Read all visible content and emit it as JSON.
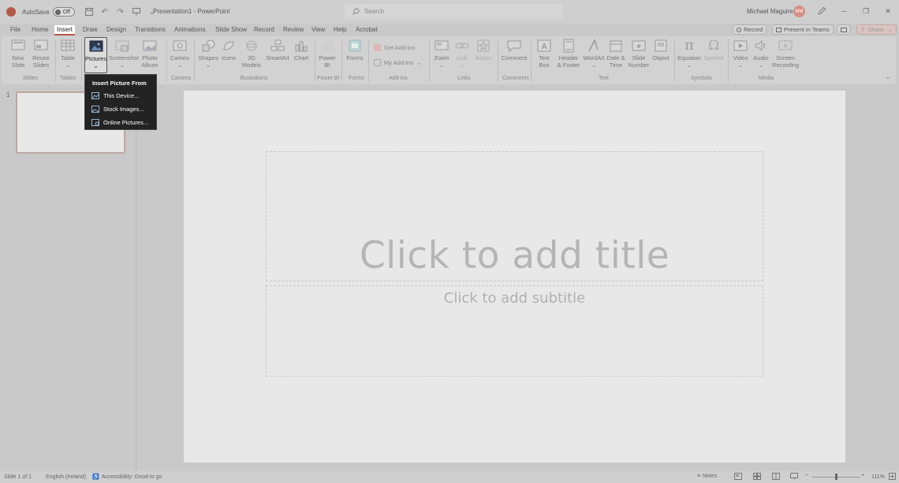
{
  "titlebar": {
    "autosave_label": "AutoSave",
    "autosave_state": "Off",
    "doc_title": "Presentation1  -  PowerPoint",
    "search_placeholder": "Search",
    "user_name": "Michael Maguire",
    "user_initials": "MM"
  },
  "tabs": [
    "File",
    "Home",
    "Insert",
    "Draw",
    "Design",
    "Transitions",
    "Animations",
    "Slide Show",
    "Record",
    "Review",
    "View",
    "Help",
    "Acrobat"
  ],
  "top_right": {
    "record": "Record",
    "present": "Present in Teams",
    "share": "Share"
  },
  "ribbon": {
    "new_slide": [
      "New",
      "Slide"
    ],
    "reuse_slides": [
      "Reuse",
      "Slides"
    ],
    "table": "Table",
    "pictures": "Pictures",
    "screenshot": "Screenshot",
    "photo_album": [
      "Photo",
      "Album"
    ],
    "cameo": "Cameo",
    "shapes": "Shapes",
    "icons": "Icons",
    "models3d": [
      "3D",
      "Models"
    ],
    "smartart": "SmartArt",
    "chart": "Chart",
    "powerbi": [
      "Power",
      "BI"
    ],
    "forms": "Forms",
    "get_addins": "Get Add-ins",
    "my_addins": "My Add-ins",
    "zoom": "Zoom",
    "link": "Link",
    "action": "Action",
    "comment": "Comment",
    "textbox": [
      "Text",
      "Box"
    ],
    "header_footer": [
      "Header",
      "& Footer"
    ],
    "wordart": "WordArt",
    "date_time": [
      "Date &",
      "Time"
    ],
    "slide_number": [
      "Slide",
      "Number"
    ],
    "object": "Object",
    "equation": "Equation",
    "symbol": "Symbol",
    "video": "Video",
    "audio": "Audio",
    "screen_recording": [
      "Screen",
      "Recording"
    ],
    "groups": {
      "slides": "Slides",
      "tables": "Tables",
      "camera": "Camera",
      "illustrations": "Illustrations",
      "powerbi": "Power BI",
      "forms": "Forms",
      "addins": "Add-ins",
      "links": "Links",
      "comments": "Comments",
      "text": "Text",
      "symbols": "Symbols",
      "media": "Media"
    }
  },
  "dropdown": {
    "heading": "Insert Picture From",
    "items": [
      "This Device...",
      "Stock Images...",
      "Online Pictures..."
    ]
  },
  "slides_pane": {
    "slide_number": "1"
  },
  "slide": {
    "title_placeholder": "Click to add title",
    "subtitle_placeholder": "Click to add subtitle"
  },
  "statusbar": {
    "slide_info": "Slide 1 of 1",
    "language": "English (Ireland)",
    "accessibility": "Accessibility: Good to go",
    "notes": "Notes",
    "zoom": "111%"
  }
}
